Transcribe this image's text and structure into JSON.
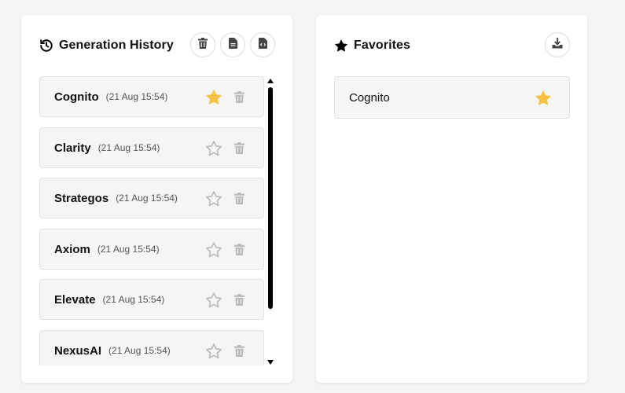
{
  "history": {
    "title": "Generation History",
    "title_icon": "history-icon",
    "buttons": [
      {
        "icon": "trash-icon",
        "name": "clear-history-button"
      },
      {
        "icon": "file-text-icon",
        "name": "export-text-button"
      },
      {
        "icon": "file-code-icon",
        "name": "export-code-button"
      }
    ],
    "items": [
      {
        "name": "Cognito",
        "time": "(21 Aug 15:54)",
        "favorited": true
      },
      {
        "name": "Clarity",
        "time": "(21 Aug 15:54)",
        "favorited": false
      },
      {
        "name": "Strategos",
        "time": "(21 Aug 15:54)",
        "favorited": false
      },
      {
        "name": "Axiom",
        "time": "(21 Aug 15:54)",
        "favorited": false
      },
      {
        "name": "Elevate",
        "time": "(21 Aug 15:54)",
        "favorited": false
      },
      {
        "name": "NexusAI",
        "time": "(21 Aug 15:54)",
        "favorited": false
      }
    ]
  },
  "favorites": {
    "title": "Favorites",
    "title_icon": "star-icon",
    "download_icon": "download-icon",
    "items": [
      {
        "name": "Cognito",
        "favorited": true
      }
    ]
  },
  "colors": {
    "star_active": "#f7c23f",
    "star_inactive": "#b9b9b9",
    "trash": "#b9b9b9",
    "background": "#f4f4f4",
    "panel": "#ffffff"
  }
}
